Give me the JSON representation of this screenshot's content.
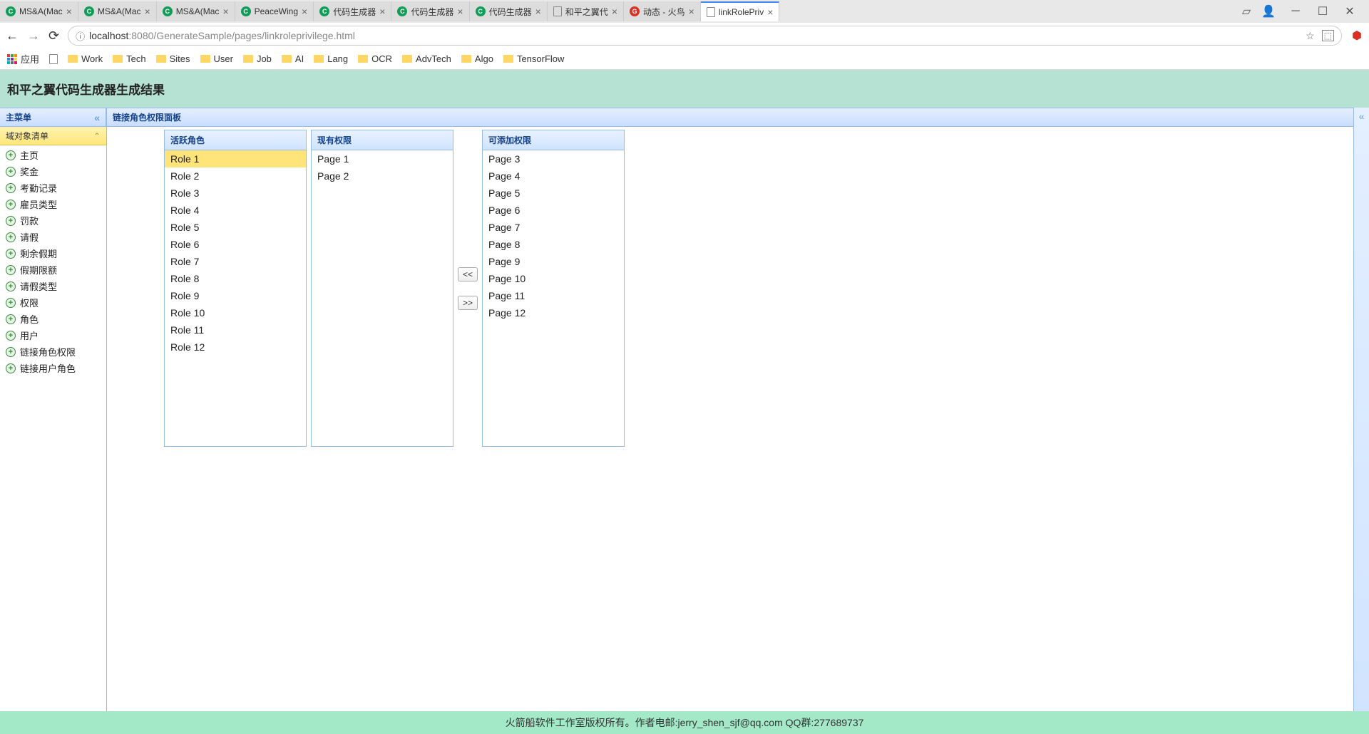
{
  "browser": {
    "tabs": [
      {
        "title": "MS&A(Mac",
        "icon": "C",
        "iconClass": "circle-green"
      },
      {
        "title": "MS&A(Mac",
        "icon": "C",
        "iconClass": "circle-green"
      },
      {
        "title": "MS&A(Mac",
        "icon": "C",
        "iconClass": "circle-green"
      },
      {
        "title": "PeaceWing",
        "icon": "C",
        "iconClass": "circle-green"
      },
      {
        "title": "代码生成器",
        "icon": "C",
        "iconClass": "circle-green"
      },
      {
        "title": "代码生成器",
        "icon": "C",
        "iconClass": "circle-green"
      },
      {
        "title": "代码生成器",
        "icon": "C",
        "iconClass": "circle-green"
      },
      {
        "title": "和平之翼代",
        "icon": "",
        "iconClass": "doc-icon"
      },
      {
        "title": "动态 - 火鸟",
        "icon": "G",
        "iconClass": "circle-red"
      },
      {
        "title": "linkRolePriv",
        "icon": "",
        "iconClass": "doc-icon",
        "active": true
      }
    ],
    "url_host": "localhost",
    "url_port": ":8080",
    "url_path": "/GenerateSample/pages/linkroleprivilege.html",
    "bookmarks_apps": "应用",
    "bookmarks": [
      "Work",
      "Tech",
      "Sites",
      "User",
      "Job",
      "AI",
      "Lang",
      "OCR",
      "AdvTech",
      "Algo",
      "TensorFlow"
    ]
  },
  "page": {
    "header": "和平之翼代码生成器生成结果",
    "sidebar": {
      "main_menu": "主菜单",
      "accordion": "域对象清单",
      "items": [
        "主页",
        "奖金",
        "考勤记录",
        "雇员类型",
        "罚款",
        "请假",
        "剩余假期",
        "假期限额",
        "请假类型",
        "权限",
        "角色",
        "用户",
        "链接角色权限",
        "链接用户角色"
      ]
    },
    "main_title": "链接角色权限面板",
    "roles": {
      "title": "活跃角色",
      "items": [
        "Role 1",
        "Role 2",
        "Role 3",
        "Role 4",
        "Role 5",
        "Role 6",
        "Role 7",
        "Role 8",
        "Role 9",
        "Role 10",
        "Role 11",
        "Role 12"
      ],
      "selected": 0
    },
    "assigned": {
      "title": "现有权限",
      "items": [
        "Page 1",
        "Page 2"
      ]
    },
    "available": {
      "title": "可添加权限",
      "items": [
        "Page 3",
        "Page 4",
        "Page 5",
        "Page 6",
        "Page 7",
        "Page 8",
        "Page 9",
        "Page 10",
        "Page 11",
        "Page 12"
      ]
    },
    "btn_add": "<<",
    "btn_remove": ">>",
    "footer": "火箭船软件工作室版权所有。作者电邮:jerry_shen_sjf@qq.com QQ群:277689737"
  }
}
